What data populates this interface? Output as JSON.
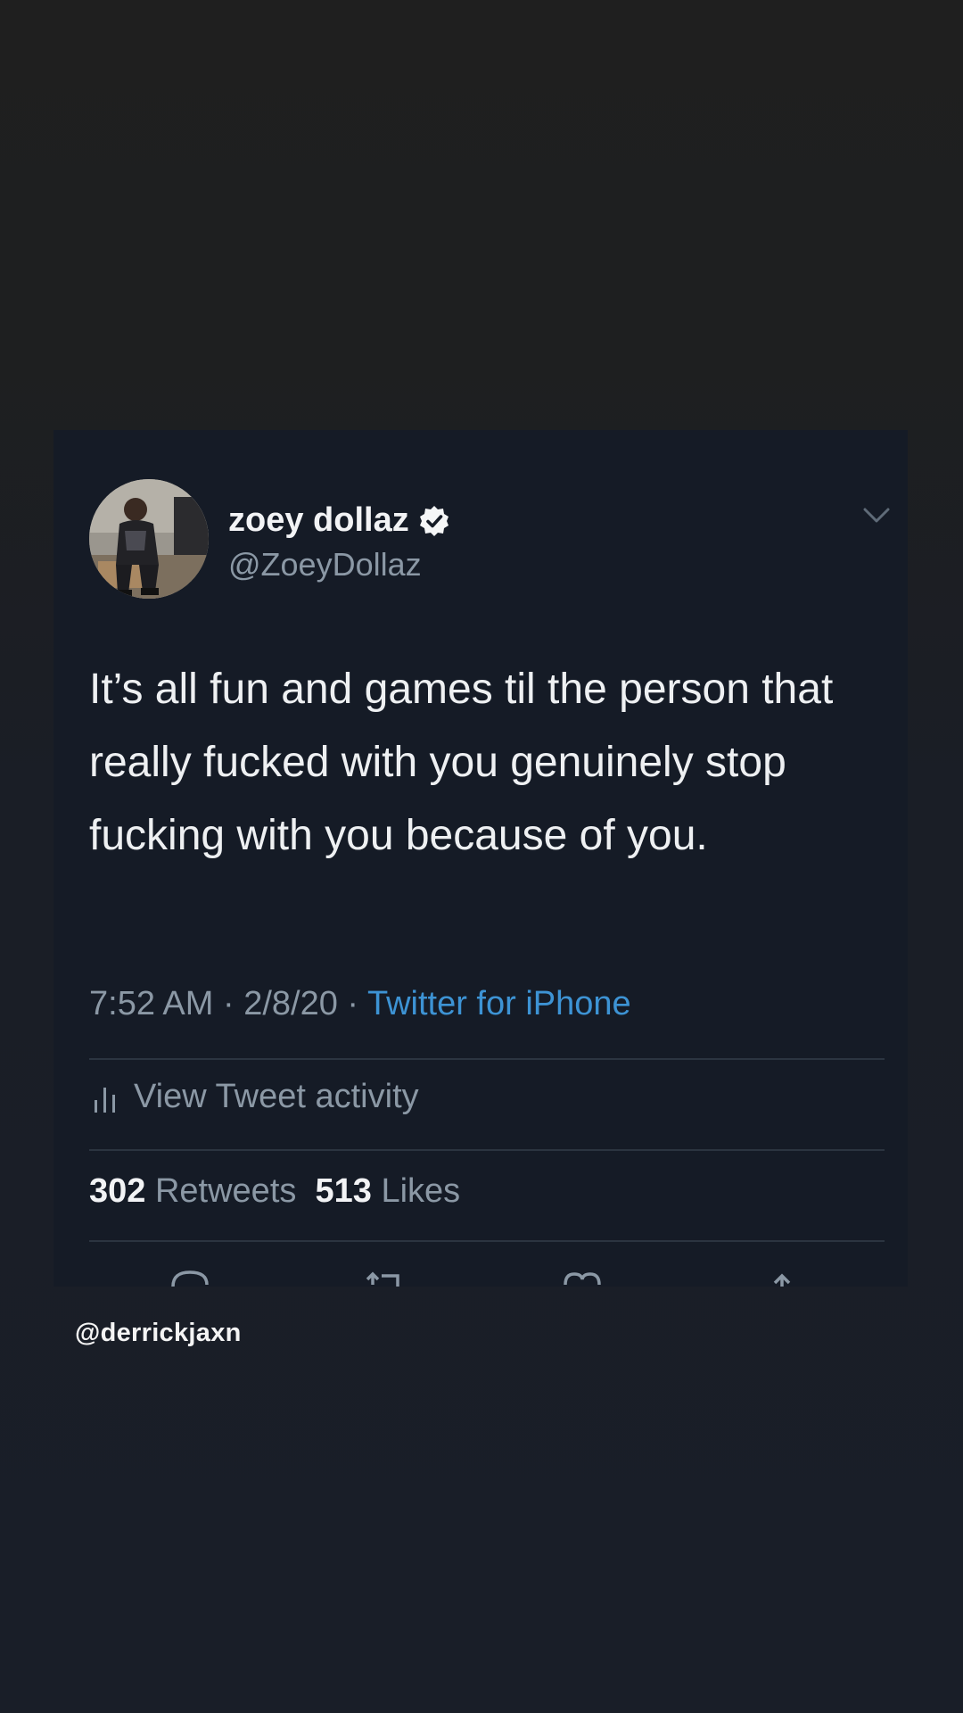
{
  "tweet": {
    "display_name": "zoey dollaz",
    "handle": "@ZoeyDollaz",
    "verified": true,
    "text": "It’s all fun and games til the person that really fucked with you genuinely stop fucking with you because of you.",
    "time": "7:52 AM",
    "date": "2/8/20",
    "separator": "·",
    "source": "Twitter for iPhone",
    "activity_label": "View Tweet activity",
    "retweets_count": "302",
    "retweets_label": "Retweets",
    "likes_count": "513",
    "likes_label": "Likes"
  },
  "icons": {
    "verified": "verified-badge-icon",
    "menu": "chevron-down-icon",
    "activity": "bar-chart-icon",
    "reply": "reply-icon",
    "retweet": "retweet-icon",
    "like": "heart-icon",
    "share": "share-icon"
  },
  "colors": {
    "card_background": "#151b26",
    "link_blue": "#3d93d4",
    "secondary_text": "#8b98a5",
    "primary_text": "#eef0f2"
  },
  "watermark": "@derrickjaxn"
}
